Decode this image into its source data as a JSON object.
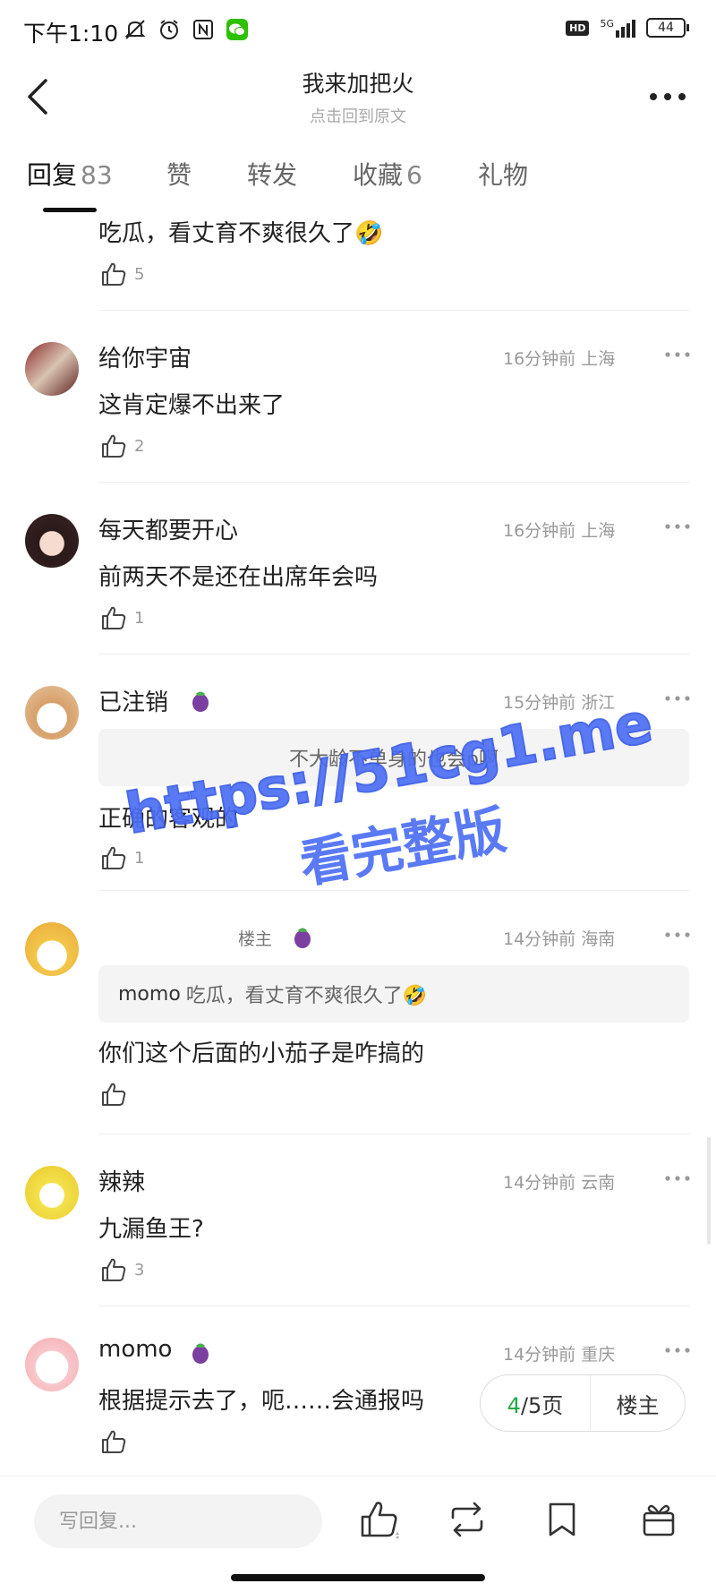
{
  "status_bar": {
    "time": "下午1:10",
    "battery": "44",
    "signal_label": "5G",
    "hd_label": "HD"
  },
  "header": {
    "title": "我来加把火",
    "subtitle": "点击回到原文"
  },
  "tabs": [
    {
      "label": "回复",
      "count": "83"
    },
    {
      "label": "赞",
      "count": ""
    },
    {
      "label": "转发",
      "count": ""
    },
    {
      "label": "收藏",
      "count": "6"
    },
    {
      "label": "礼物",
      "count": ""
    }
  ],
  "comments": [
    {
      "username": "",
      "time": "",
      "location": "",
      "content": "吃瓜，看丈育不爽很久了🤣",
      "likes": "5"
    },
    {
      "username": "给你宇宙",
      "time": "16分钟前",
      "location": "上海",
      "content": "这肯定爆不出来了",
      "likes": "2"
    },
    {
      "username": "每天都要开心",
      "time": "16分钟前",
      "location": "上海",
      "content": "前两天不是还在出席年会吗",
      "likes": "1"
    },
    {
      "username": "已注销",
      "time": "15分钟前",
      "location": "浙江",
      "quote": "不大龄不单身的也会p啊",
      "content": "正确的客观的",
      "likes": "1"
    },
    {
      "username": "",
      "owner_tag": "楼主",
      "time": "14分钟前",
      "location": "海南",
      "quote_author": "momo",
      "quote": "吃瓜，看丈育不爽很久了🤣",
      "content": "你们这个后面的小茄子是咋搞的",
      "likes": ""
    },
    {
      "username": "辣辣",
      "time": "14分钟前",
      "location": "云南",
      "content": "九漏鱼王?",
      "likes": "3"
    },
    {
      "username": "momo",
      "time": "14分钟前",
      "location": "重庆",
      "content": "根据提示去了，呃……会通报吗",
      "likes": ""
    }
  ],
  "pager": {
    "current": "4",
    "total_label": "/5页",
    "owner_label": "楼主"
  },
  "watermark": {
    "line1": "https://51cg1.me",
    "line2": "看完整版"
  },
  "bottom_bar": {
    "reply_placeholder": "写回复..."
  },
  "colors": {
    "accent_green": "#27a844",
    "watermark_blue": "#4d6ff5",
    "eggplant": "#7b3fa0"
  }
}
